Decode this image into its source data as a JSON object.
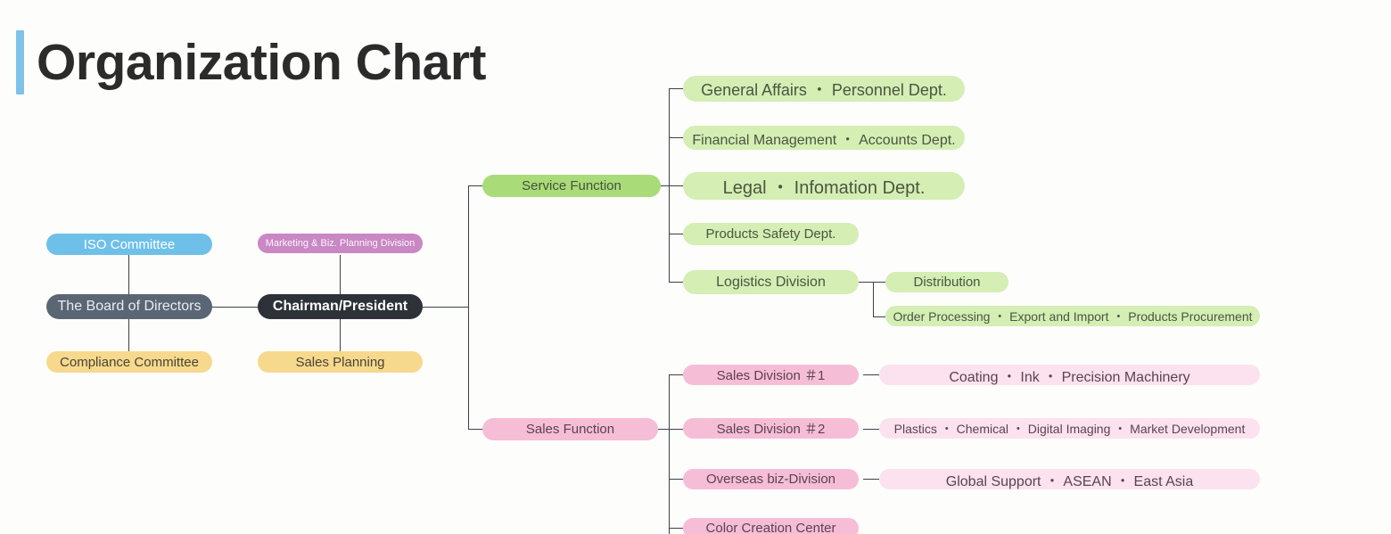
{
  "page": {
    "title": "Organization Chart",
    "accent_color": "#7ec2ea",
    "background_color": "#fdfdfc"
  },
  "palette": {
    "blue": "#6fc0e9",
    "slate": "#5b6674",
    "yellow": "#f6d98d",
    "orchid": "#c987c4",
    "dark": "#2d3138",
    "green": "#a9dc79",
    "green_light": "#d4eeb4",
    "pink": "#f6bdd6",
    "pink_light": "#fbe2ee",
    "connector": "#3d4147"
  },
  "chart_data": {
    "type": "diagram",
    "title": "Organization Chart",
    "nodes": {
      "iso_committee": "ISO Committee",
      "board_of_directors": "The Board of Directors",
      "compliance_committee": "Compliance Committee",
      "marketing_division": "Marketing & Biz. Planning Division",
      "chairman_president": "Chairman/President",
      "sales_planning": "Sales Planning",
      "service_function": "Service Function",
      "sales_function": "Sales Function"
    },
    "service_children": [
      "General Affairs ・ Personnel Dept.",
      "Financial Management ・ Accounts Dept.",
      "Legal ・ Infomation Dept.",
      "Products Safety Dept.",
      "Logistics Division"
    ],
    "logistics_children": [
      "Distribution",
      "Order Processing ・ Export and Import ・ Products Procurement"
    ],
    "sales_children": [
      "Sales Division ＃2",
      "Sales Division ＃1",
      "Overseas biz-Division",
      "Color Creation Center"
    ],
    "sales_divisions": [
      {
        "division": "Sales Division ＃1",
        "detail": "Coating ・ Ink ・ Precision Machinery"
      },
      {
        "division": "Sales Division ＃2",
        "detail": "Plastics ・ Chemical ・ Digital Imaging ・ Market Development"
      },
      {
        "division": "Overseas biz-Division",
        "detail": "Global Support ・ ASEAN ・ East Asia"
      },
      {
        "division": "Color Creation Center",
        "detail": ""
      }
    ]
  },
  "left_cluster": {
    "iso_committee": "ISO Committee",
    "board_of_directors": "The Board of Directors",
    "compliance_committee": "Compliance Committee",
    "marketing_division": "Marketing & Biz. Planning Division",
    "chairman_president": "Chairman/President",
    "sales_planning": "Sales Planning"
  },
  "service_branch": {
    "header": "Service Function",
    "children": [
      {
        "label": "General Affairs ・ Personnel Dept."
      },
      {
        "label": "Financial Management ・ Accounts Dept."
      },
      {
        "label": "Legal ・ Infomation Dept."
      },
      {
        "label": "Products Safety Dept."
      },
      {
        "label": "Logistics Division"
      }
    ],
    "logistics_children": [
      {
        "label": "Distribution"
      },
      {
        "label": "Order Processing ・ Export and Import ・ Products Procurement"
      }
    ]
  },
  "sales_branch": {
    "header": "Sales Function",
    "children": [
      {
        "label": "Sales Division ＃1",
        "detail": "Coating ・ Ink ・ Precision Machinery"
      },
      {
        "label": "Sales Division ＃2",
        "detail": "Plastics ・ Chemical ・ Digital Imaging ・ Market Development"
      },
      {
        "label": "Overseas biz-Division",
        "detail": "Global Support ・ ASEAN ・ East Asia"
      },
      {
        "label": "Color Creation Center",
        "detail": ""
      }
    ]
  }
}
